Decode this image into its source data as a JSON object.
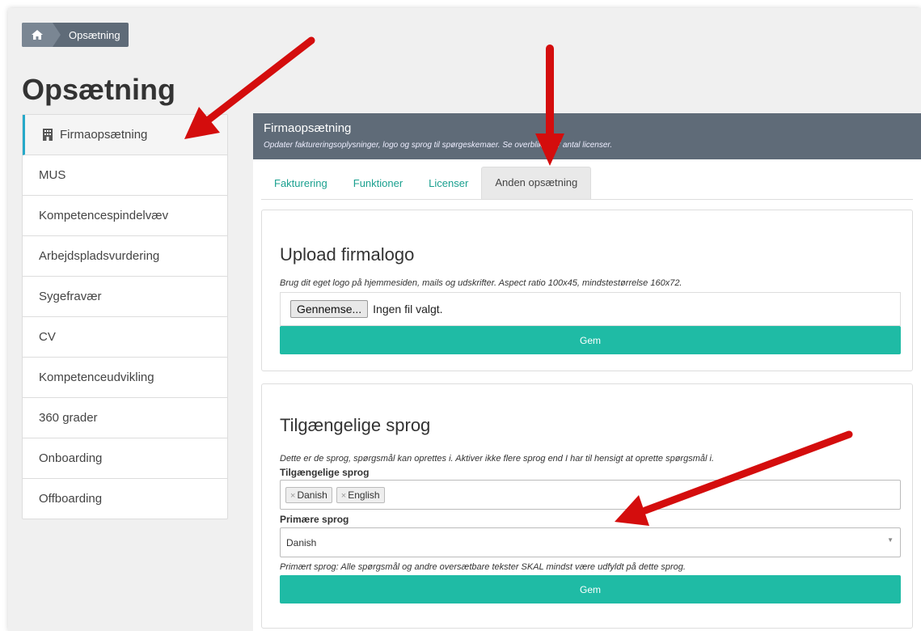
{
  "breadcrumb": {
    "home_icon": "home-icon",
    "current": "Opsætning"
  },
  "page_title": "Opsætning",
  "sidebar": {
    "items": [
      {
        "label": "Firmaopsætning",
        "icon": "building-icon",
        "active": true
      },
      {
        "label": "MUS"
      },
      {
        "label": "Kompetencespindelvæv"
      },
      {
        "label": "Arbejdspladsvurdering"
      },
      {
        "label": "Sygefravær"
      },
      {
        "label": "CV"
      },
      {
        "label": "Kompetenceudvikling"
      },
      {
        "label": "360 grader"
      },
      {
        "label": "Onboarding"
      },
      {
        "label": "Offboarding"
      }
    ]
  },
  "panel": {
    "title": "Firmaopsætning",
    "subtitle": "Opdater faktureringsoplysninger, logo og sprog til spørgeskemaer. Se overblik over antal licenser."
  },
  "tabs": [
    {
      "label": "Fakturering"
    },
    {
      "label": "Funktioner"
    },
    {
      "label": "Licenser"
    },
    {
      "label": "Anden opsætning",
      "active": true
    }
  ],
  "logo_section": {
    "title": "Upload firmalogo",
    "description": "Brug dit eget logo på hjemmesiden, mails og udskrifter. Aspect ratio 100x45, mindstestørrelse 160x72.",
    "browse_label": "Gennemse...",
    "no_file_text": "Ingen fil valgt.",
    "save_label": "Gem"
  },
  "language_section": {
    "title": "Tilgængelige sprog",
    "description": "Dette er de sprog, spørgsmål kan oprettes i. Aktiver ikke flere sprog end I har til hensigt at oprette spørgsmål i.",
    "available_label": "Tilgængelige sprog",
    "tags": [
      {
        "label": "Danish"
      },
      {
        "label": "English"
      }
    ],
    "tag_remove": "×",
    "primary_label": "Primære sprog",
    "primary_value": "Danish",
    "caret": "▼",
    "hint": "Primært sprog: Alle spørgsmål og andre oversætbare tekster SKAL mindst være udfyldt på dette sprog.",
    "save_label": "Gem"
  },
  "colors": {
    "accent": "#1fbba5",
    "header": "#5f6b78",
    "arrow": "#d40d0d",
    "active_marker": "#26a9c9"
  }
}
